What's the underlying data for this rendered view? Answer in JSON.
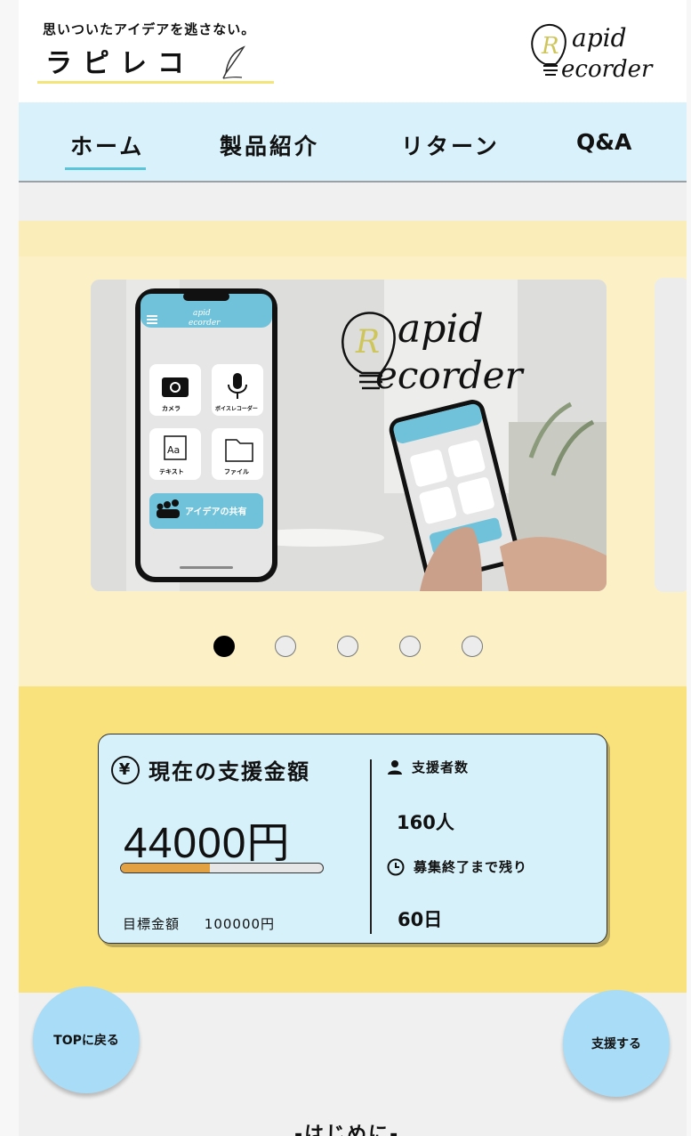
{
  "header": {
    "tagline": "思いついたアイデアを逃さない。",
    "logo_text": "ラピレコ",
    "brand_logo": {
      "letter_top": "R",
      "line1": "apid",
      "line2": "ecorder",
      "icon": "lightbulb-icon"
    }
  },
  "nav": {
    "items": [
      {
        "label": "ホーム",
        "active": true
      },
      {
        "label": "製品紹介",
        "active": false
      },
      {
        "label": "リターン",
        "active": false
      },
      {
        "label": "Q&A",
        "active": false
      }
    ]
  },
  "carousel": {
    "slide": {
      "logo": {
        "line1": "apid",
        "line2": "ecorder"
      },
      "app_header": {
        "line1": "apid",
        "line2": "ecorder"
      },
      "app_buttons": [
        "カメラ",
        "ボイスレコーダー",
        "テキスト",
        "ファイル"
      ],
      "share_button": "アイデアの共有"
    },
    "dots": 5,
    "active_index": 0
  },
  "funding": {
    "title": "現在の支援金額",
    "amount": "44000円",
    "progress": 0.44,
    "goal_label": "目標金額",
    "goal_value": "100000円",
    "supporters_label": "支援者数",
    "supporters_value": "160人",
    "remaining_label": "募集終了まで残り",
    "remaining_value": "60日",
    "colors": {
      "card_bg": "#d7f1fa",
      "progress_fill": "#e2a243",
      "section_bg": "#f9e17b"
    }
  },
  "buttons": {
    "top": "TOPに戻る",
    "support": "支援する"
  },
  "section": {
    "heading": "-はじめに-"
  }
}
